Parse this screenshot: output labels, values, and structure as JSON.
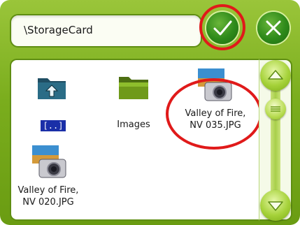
{
  "header": {
    "path": "\\StorageCard",
    "ok_icon": "checkmark-icon",
    "cancel_icon": "close-icon"
  },
  "files": [
    {
      "label": "[..]",
      "icon": "parent-folder-icon"
    },
    {
      "label": "Images",
      "icon": "folder-icon"
    },
    {
      "label_line1": "Valley of Fire,",
      "label_line2": "NV 035.JPG",
      "icon": "image-file-icon"
    },
    {
      "label_line1": "Valley of Fire,",
      "label_line2": "NV 020.JPG",
      "icon": "image-file-icon"
    }
  ],
  "scrollbar": {
    "up_icon": "arrow-up-icon",
    "down_icon": "arrow-down-icon"
  },
  "colors": {
    "frame": "#7aad1d",
    "button": "#2e8a1a",
    "highlight_ring": "#e01a1a",
    "selection": "#1a2fa8"
  }
}
